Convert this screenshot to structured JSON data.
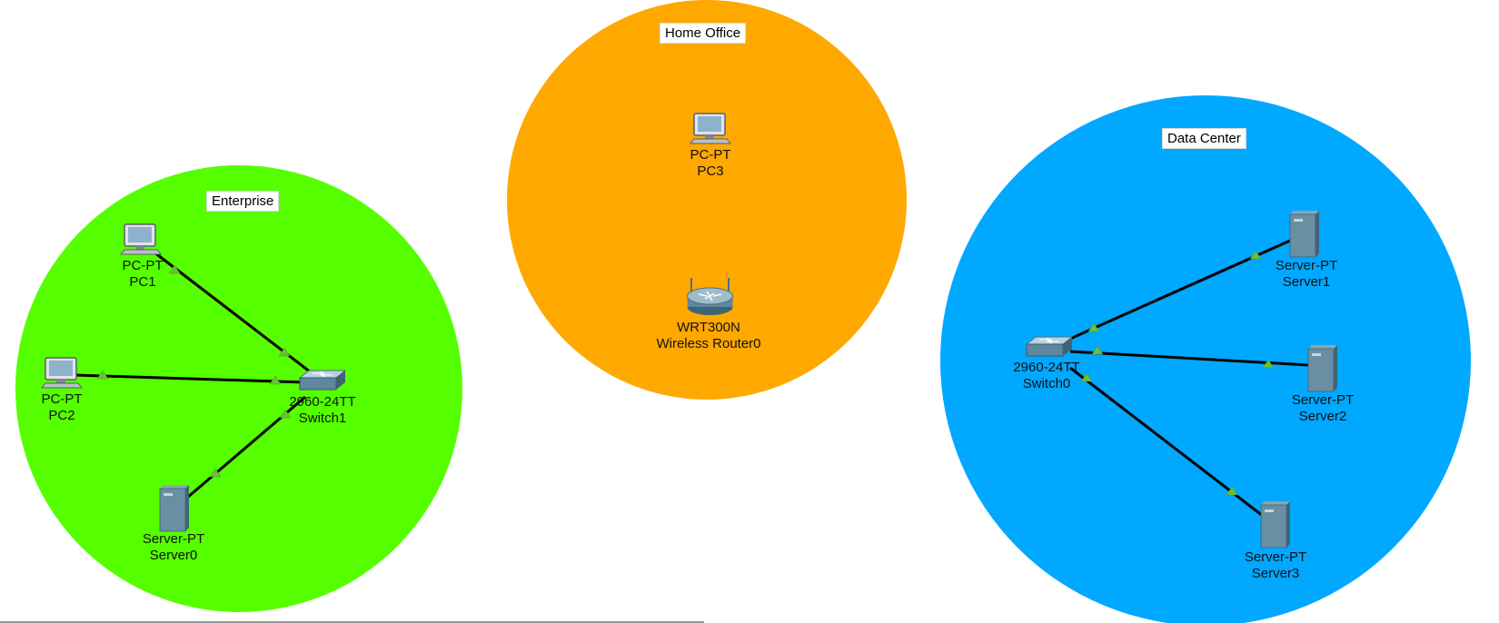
{
  "colors": {
    "enterprise_zone": "#55ff00",
    "home_office_zone": "#ffa800",
    "data_center_zone": "#00a8ff",
    "cable": "#000000",
    "link_indicator": "#6abf3a"
  },
  "zones": {
    "enterprise": {
      "label": "Enterprise"
    },
    "home_office": {
      "label": "Home Office"
    },
    "data_center": {
      "label": "Data Center"
    }
  },
  "devices": {
    "pc1": {
      "model": "PC-PT",
      "name": "PC1",
      "icon": "desktop-pc-icon"
    },
    "pc2": {
      "model": "PC-PT",
      "name": "PC2",
      "icon": "desktop-pc-icon"
    },
    "server0": {
      "model": "Server-PT",
      "name": "Server0",
      "icon": "server-icon"
    },
    "switch1": {
      "model": "2960-24TT",
      "name": "Switch1",
      "icon": "switch-icon"
    },
    "pc3": {
      "model": "PC-PT",
      "name": "PC3",
      "icon": "desktop-pc-icon"
    },
    "router0": {
      "model": "WRT300N",
      "name": "Wireless Router0",
      "icon": "wireless-router-icon"
    },
    "switch0": {
      "model": "2960-24TT",
      "name": "Switch0",
      "icon": "switch-icon"
    },
    "server1": {
      "model": "Server-PT",
      "name": "Server1",
      "icon": "server-icon"
    },
    "server2": {
      "model": "Server-PT",
      "name": "Server2",
      "icon": "server-icon"
    },
    "server3": {
      "model": "Server-PT",
      "name": "Server3",
      "icon": "server-icon"
    }
  },
  "links": [
    {
      "from": "pc1",
      "to": "switch1",
      "status": "up"
    },
    {
      "from": "pc2",
      "to": "switch1",
      "status": "up"
    },
    {
      "from": "server0",
      "to": "switch1",
      "status": "up"
    },
    {
      "from": "switch0",
      "to": "server1",
      "status": "up"
    },
    {
      "from": "switch0",
      "to": "server2",
      "status": "up"
    },
    {
      "from": "switch0",
      "to": "server3",
      "status": "up"
    }
  ]
}
